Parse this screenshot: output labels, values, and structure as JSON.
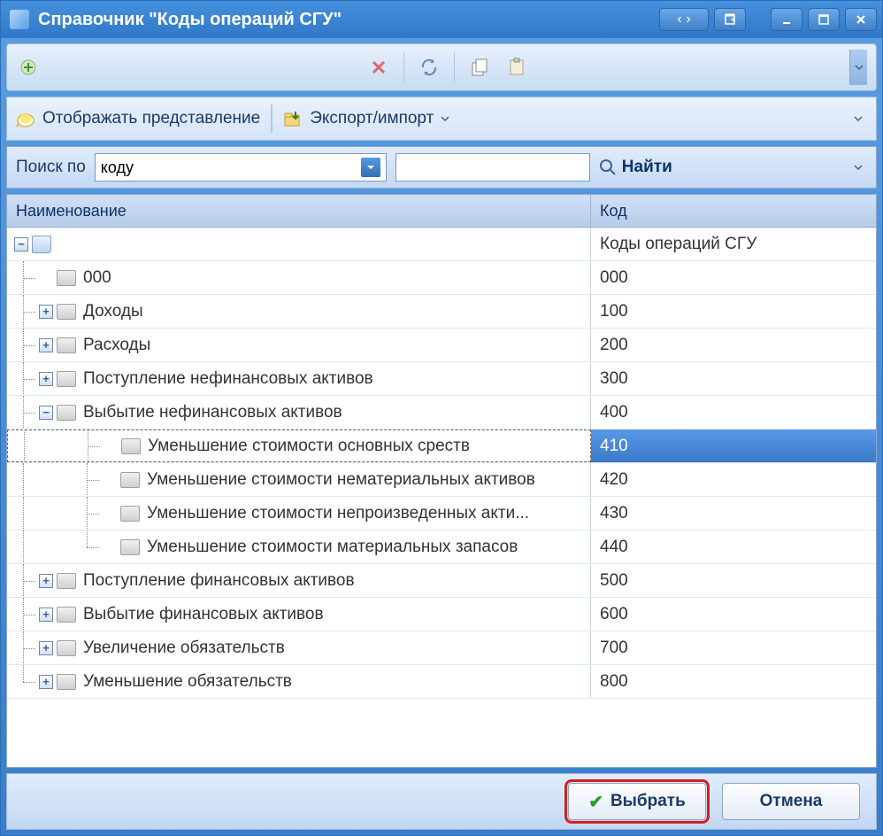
{
  "window": {
    "title": "Справочник \"Коды операций СГУ\""
  },
  "toolbar2": {
    "view_label": "Отображать представление",
    "export_label": "Экспорт/импорт"
  },
  "search": {
    "label": "Поиск по",
    "combo_value": "коду",
    "input_value": "",
    "find_label": "Найти"
  },
  "columns": {
    "name": "Наименование",
    "code": "Код"
  },
  "root": {
    "name": "",
    "code": "Коды операций СГУ"
  },
  "rows": [
    {
      "name": "000",
      "code": "000",
      "level": 1,
      "toggle": "",
      "last": false
    },
    {
      "name": "Доходы",
      "code": "100",
      "level": 1,
      "toggle": "+",
      "last": false
    },
    {
      "name": "Расходы",
      "code": "200",
      "level": 1,
      "toggle": "+",
      "last": false
    },
    {
      "name": "Поступление нефинансовых активов",
      "code": "300",
      "level": 1,
      "toggle": "+",
      "last": false
    },
    {
      "name": "Выбытие нефинансовых активов",
      "code": "400",
      "level": 1,
      "toggle": "-",
      "last": false
    },
    {
      "name": "Уменьшение стоимости основных среств",
      "code": "410",
      "level": 2,
      "toggle": "",
      "selected": true,
      "last": false
    },
    {
      "name": "Уменьшение стоимости нематериальных активов",
      "code": "420",
      "level": 2,
      "toggle": "",
      "last": false
    },
    {
      "name": "Уменьшение стоимости непроизведенных акти...",
      "code": "430",
      "level": 2,
      "toggle": "",
      "last": false
    },
    {
      "name": "Уменьшение стоимости материальных запасов",
      "code": "440",
      "level": 2,
      "toggle": "",
      "last": true
    },
    {
      "name": "Поступление финансовых активов",
      "code": "500",
      "level": 1,
      "toggle": "+",
      "last": false
    },
    {
      "name": "Выбытие финансовых активов",
      "code": "600",
      "level": 1,
      "toggle": "+",
      "last": false
    },
    {
      "name": "Увеличение обязательств",
      "code": "700",
      "level": 1,
      "toggle": "+",
      "last": false
    },
    {
      "name": "Уменьшение обязательств",
      "code": "800",
      "level": 1,
      "toggle": "+",
      "last": true
    }
  ],
  "footer": {
    "select": "Выбрать",
    "cancel": "Отмена"
  }
}
